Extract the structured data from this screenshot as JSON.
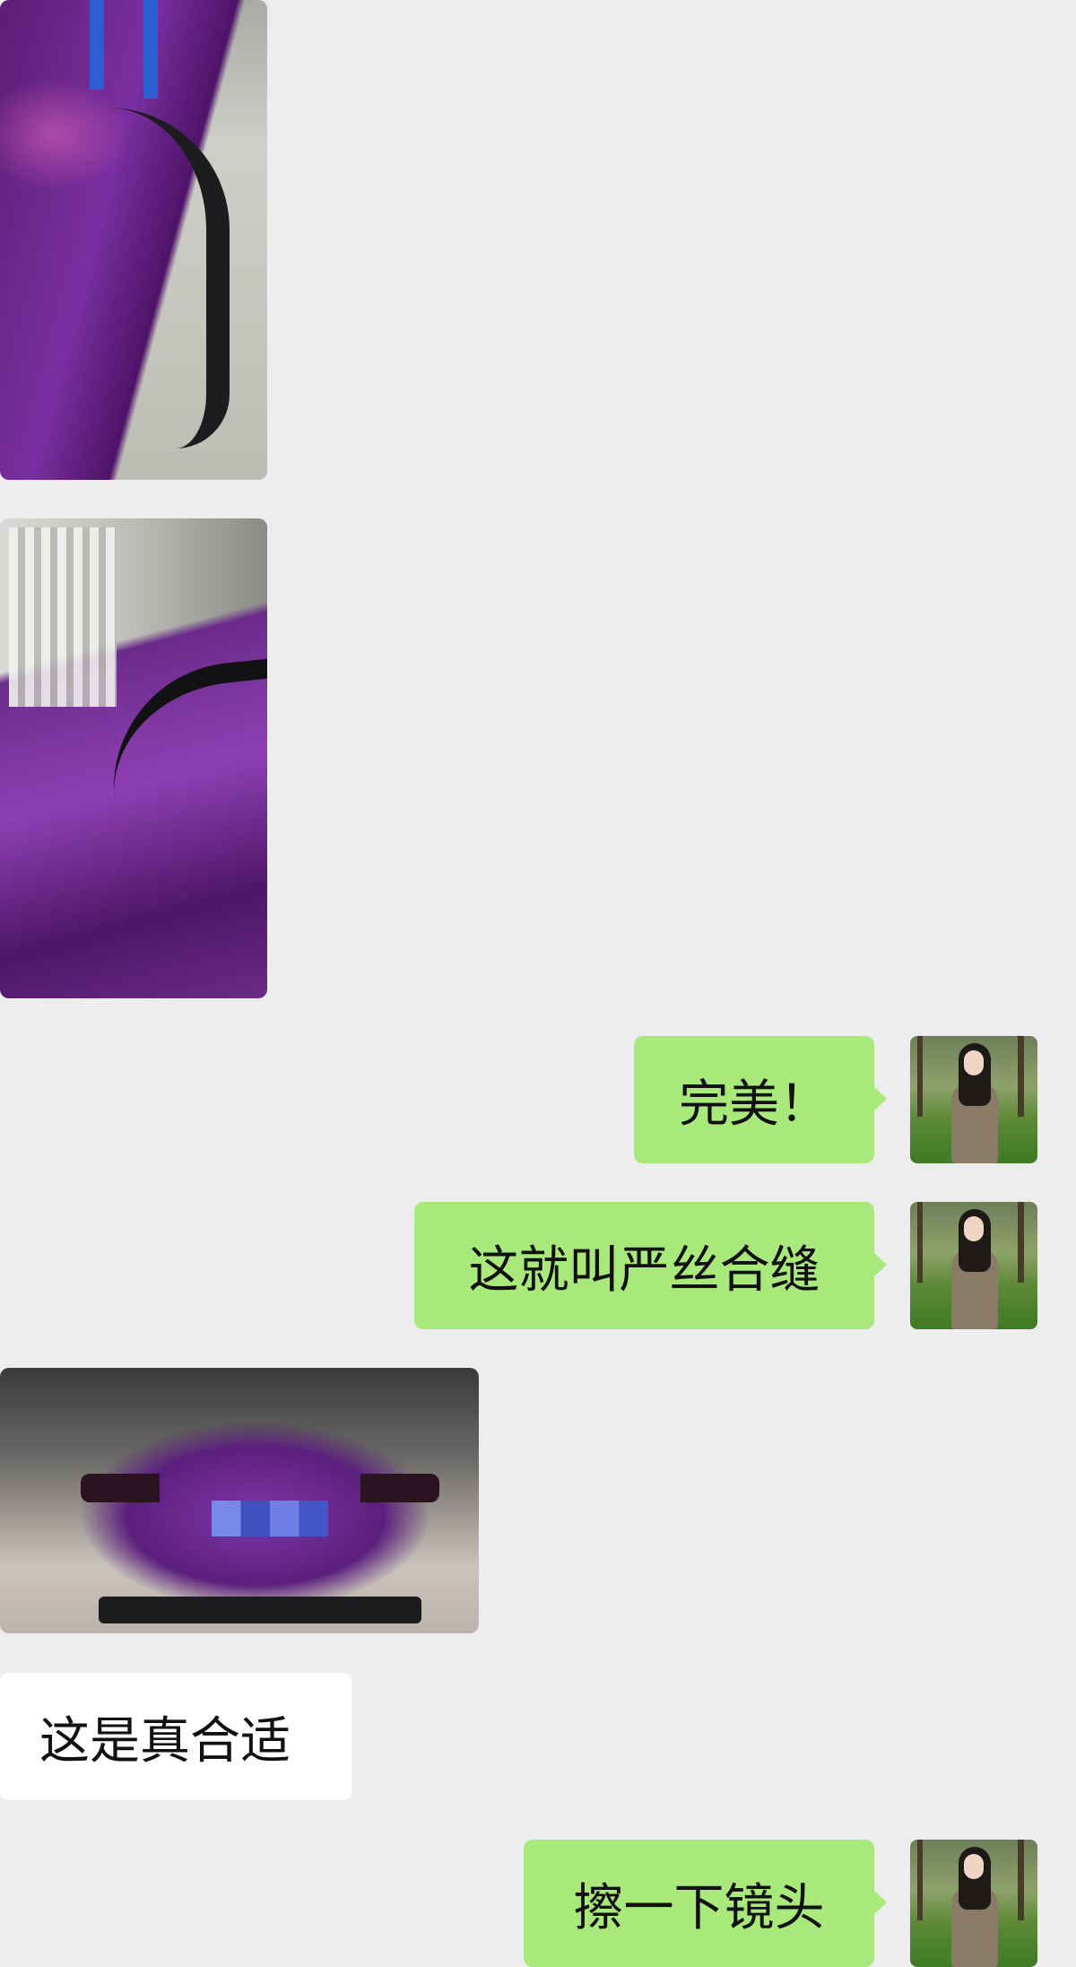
{
  "messages": [
    {
      "type": "image",
      "direction": "incoming",
      "description_icon": "photo-icon"
    },
    {
      "type": "image",
      "direction": "incoming",
      "description_icon": "photo-icon"
    },
    {
      "type": "text",
      "direction": "outgoing",
      "text": "完美！"
    },
    {
      "type": "text",
      "direction": "outgoing",
      "text": "这就叫严丝合缝"
    },
    {
      "type": "image",
      "direction": "incoming",
      "description_icon": "photo-icon"
    },
    {
      "type": "text",
      "direction": "incoming",
      "text": "这是真合适"
    },
    {
      "type": "text",
      "direction": "outgoing",
      "text": "擦一下镜头"
    }
  ],
  "colors": {
    "background": "#ededed",
    "outgoing_bubble": "#a9e97b",
    "incoming_bubble": "#ffffff",
    "text": "#111111"
  }
}
